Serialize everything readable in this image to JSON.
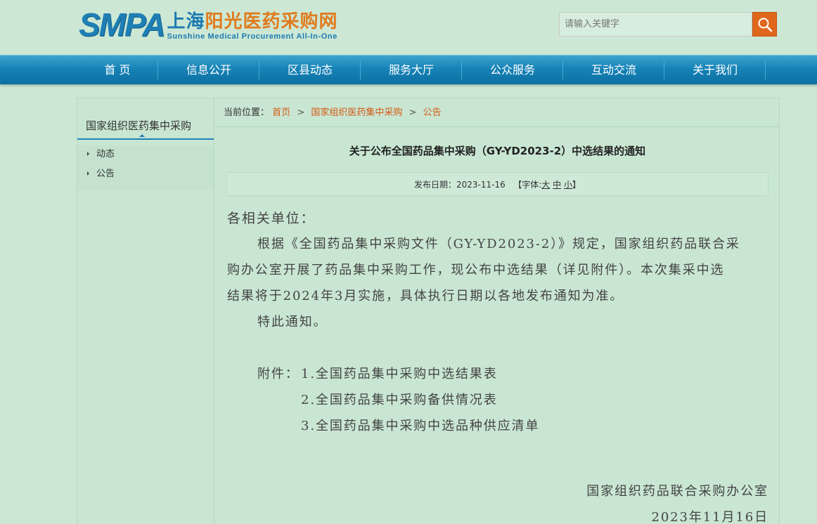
{
  "header": {
    "logo_abbr": "SMPA",
    "logo_cn_part1": "上海",
    "logo_cn_part2": "阳光医药采购网",
    "logo_en": "Sunshine Medical Procurement All-In-One",
    "search_placeholder": "请输入关键字",
    "search_icon": "search-icon"
  },
  "nav": {
    "items": [
      "首 页",
      "信息公开",
      "区县动态",
      "服务大厅",
      "公众服务",
      "互动交流",
      "关于我们"
    ]
  },
  "sidebar": {
    "title": "国家组织医药集中采购",
    "items": [
      "动态",
      "公告"
    ]
  },
  "breadcrumb": {
    "prefix": "当前位置：",
    "items": [
      "首页",
      "国家组织医药集中采购",
      "公告"
    ],
    "separator": ">"
  },
  "article": {
    "title": "关于公布全国药品集中采购（GY-YD2023-2）中选结果的通知",
    "date_label": "发布日期：",
    "date": "2023-11-16",
    "font_label_open": "【字体:",
    "font_large": "大",
    "font_medium": "中",
    "font_small": "小",
    "font_label_close": "】",
    "salutation": "各相关单位：",
    "lines": [
      "根据《全国药品集中采购文件（GY-YD2023-2）》规定，国家组织药品联合采",
      "购办公室开展了药品集中采购工作，现公布中选结果（详见附件）。本次集采中选",
      "结果将于2024年3月实施，具体执行日期以各地发布通知为准。",
      "特此通知。"
    ],
    "attachments_label": "附件：",
    "attachments": [
      "1.全国药品集中采购中选结果表",
      "2.全国药品集中采购备供情况表",
      "3.全国药品集中采购中选品种供应清单"
    ],
    "signature": "国家组织药品联合采购办公室",
    "signature_date": "2023年11月16日"
  }
}
